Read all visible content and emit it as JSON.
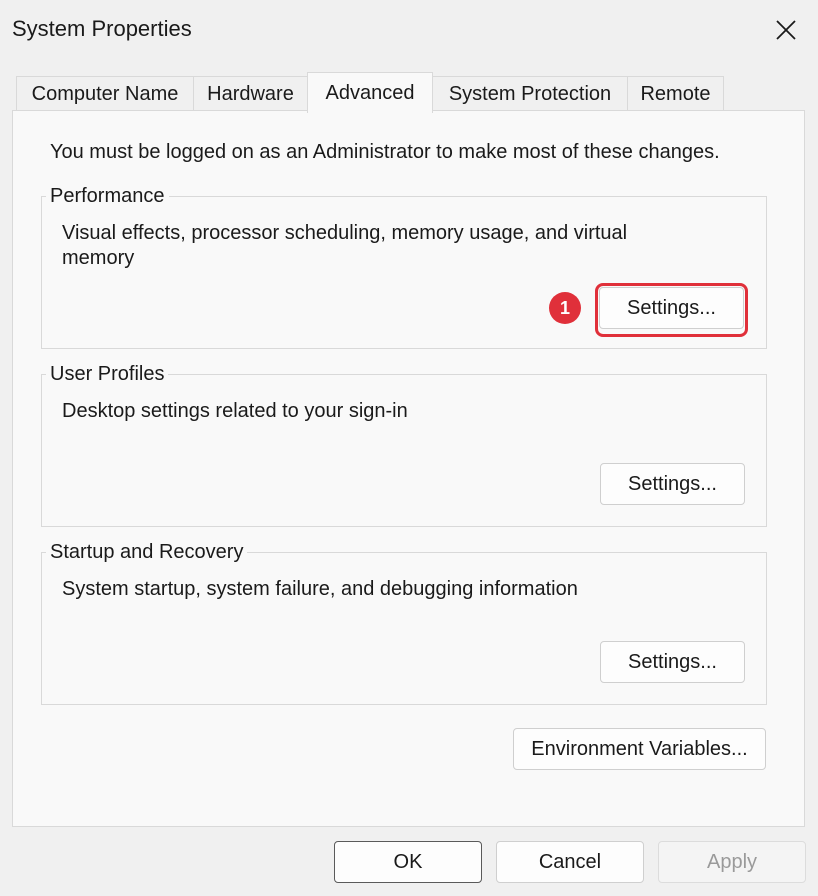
{
  "window": {
    "title": "System Properties"
  },
  "tabs": [
    {
      "label": "Computer Name"
    },
    {
      "label": "Hardware"
    },
    {
      "label": "Advanced",
      "active": true
    },
    {
      "label": "System Protection"
    },
    {
      "label": "Remote"
    }
  ],
  "advanced": {
    "admin_note": "You must be logged on as an Administrator to make most of these changes.",
    "performance": {
      "title": "Performance",
      "description": "Visual effects, processor scheduling, memory usage, and virtual memory",
      "button_label": "Settings..."
    },
    "user_profiles": {
      "title": "User Profiles",
      "description": "Desktop settings related to your sign-in",
      "button_label": "Settings..."
    },
    "startup_recovery": {
      "title": "Startup and Recovery",
      "description": "System startup, system failure, and debugging information",
      "button_label": "Settings..."
    },
    "env_vars_label": "Environment Variables..."
  },
  "annotation": {
    "step": "1",
    "color": "#e0303a"
  },
  "footer": {
    "ok_label": "OK",
    "cancel_label": "Cancel",
    "apply_label": "Apply"
  },
  "icons": {
    "close": "close-icon"
  }
}
